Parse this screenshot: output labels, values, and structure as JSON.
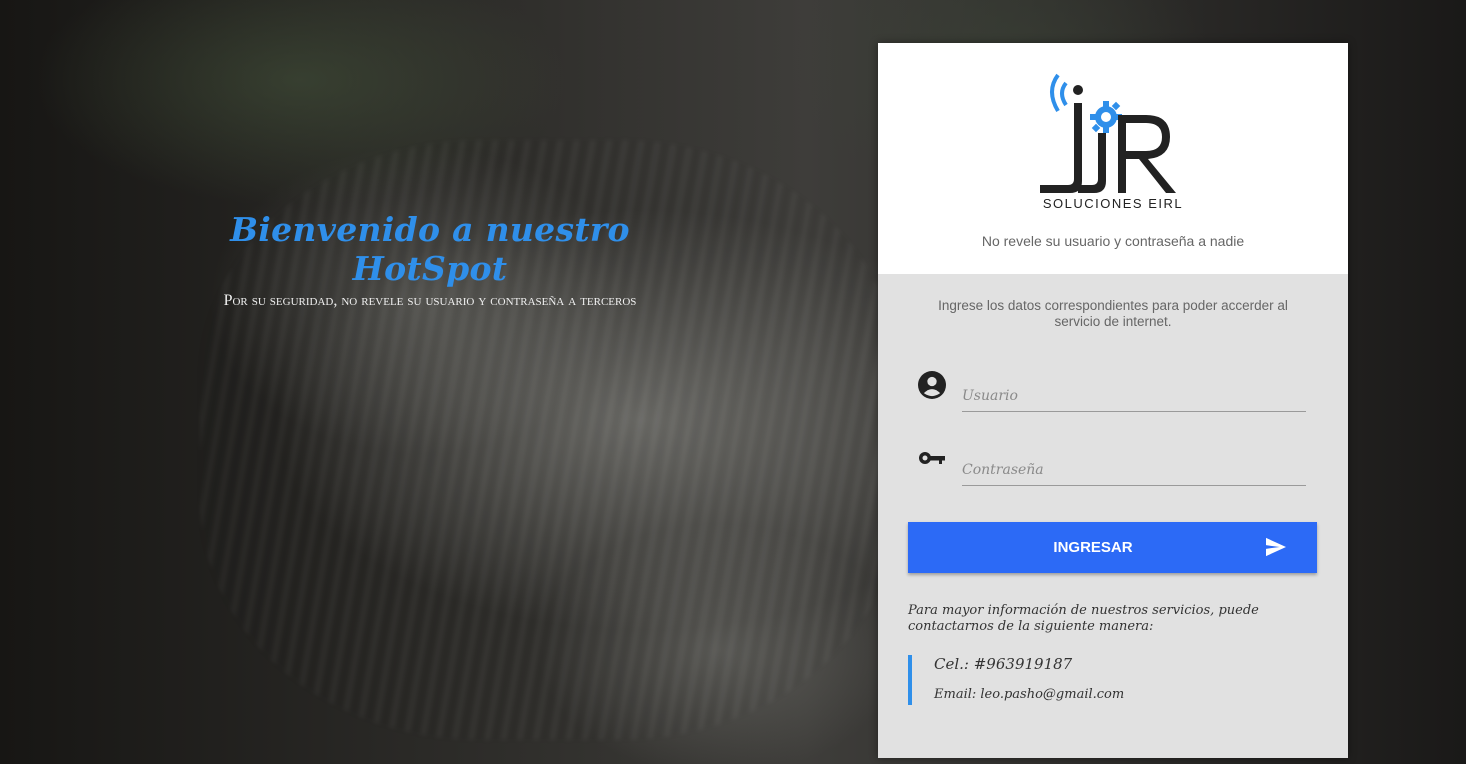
{
  "welcome": {
    "title": "Bienvenido a nuestro HotSpot",
    "subtitle": "Por su seguridad, no revele su usuario y contraseña a terceros"
  },
  "card": {
    "logo_text": "JJR",
    "logo_sub": "SOLUCIONES EIRL",
    "tagline": "No revele su usuario y contraseña a nadie",
    "intro": "Ingrese los datos correspondientes para poder accerder al servicio de internet.",
    "username": {
      "placeholder": "Usuario",
      "value": "",
      "icon": "account-circle-icon"
    },
    "password": {
      "placeholder": "Contraseña",
      "value": "",
      "icon": "key-icon"
    },
    "submit_label": "INGRESAR",
    "submit_icon": "send-icon",
    "info": "Para mayor información de nuestros servicios, puede contactarnos de la siguiente manera:",
    "contact": {
      "cel": "Cel.: #963919187",
      "email": "Email: leo.pasho@gmail.com"
    }
  },
  "colors": {
    "accent": "#2f8fea",
    "button": "#2c6af6",
    "card_bg": "#e1e1e1",
    "card_header_bg": "#ffffff"
  }
}
